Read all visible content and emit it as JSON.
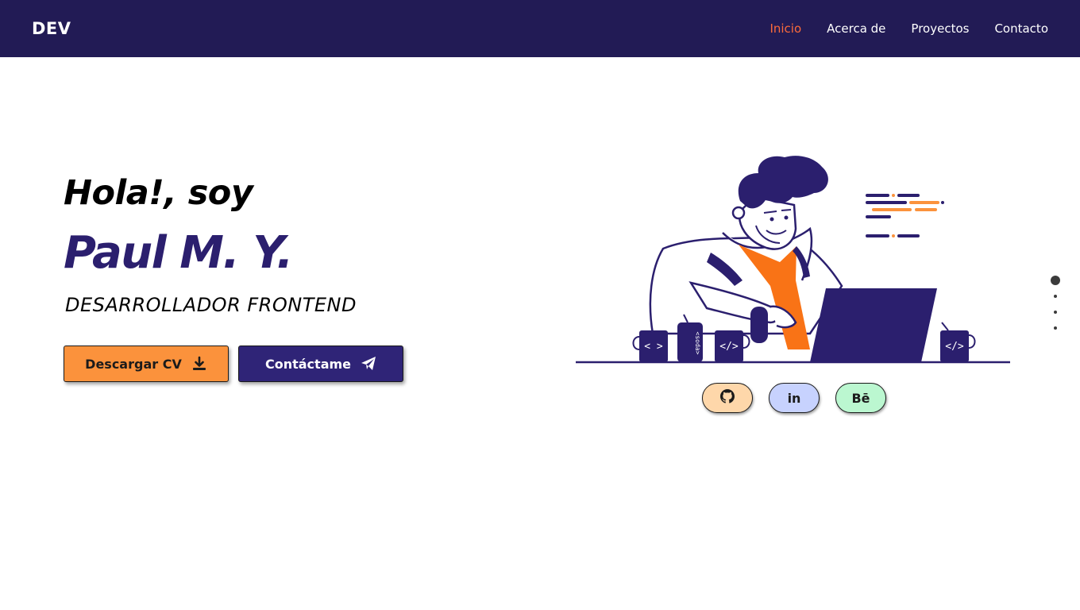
{
  "nav": {
    "brand": "DEV",
    "links": [
      {
        "label": "Inicio",
        "active": true
      },
      {
        "label": "Acerca de",
        "active": false
      },
      {
        "label": "Proyectos",
        "active": false
      },
      {
        "label": "Contacto",
        "active": false
      }
    ]
  },
  "hero": {
    "greeting": "Hola!, soy",
    "name": "Paul M. Y.",
    "role": "DESARROLLADOR FRONTEND",
    "buttons": {
      "cv_label": "Descargar CV",
      "cv_icon": "download-icon",
      "contact_label": "Contáctame",
      "contact_icon": "paper-plane-icon"
    }
  },
  "illustration": {
    "mug_labels": [
      "< >",
      "</>",
      "</>"
    ],
    "can_label": "<soda>"
  },
  "social": [
    {
      "name": "github-icon",
      "label": ""
    },
    {
      "name": "linkedin-icon",
      "label": "in"
    },
    {
      "name": "behance-icon",
      "label": "Bē"
    }
  ],
  "colors": {
    "nav_bg": "#221b55",
    "accent_orange": "#fb923c",
    "primary_purple": "#2f2477",
    "active_link": "#fb6a3b"
  },
  "section_indicator": {
    "count": 4,
    "active_index": 0
  }
}
